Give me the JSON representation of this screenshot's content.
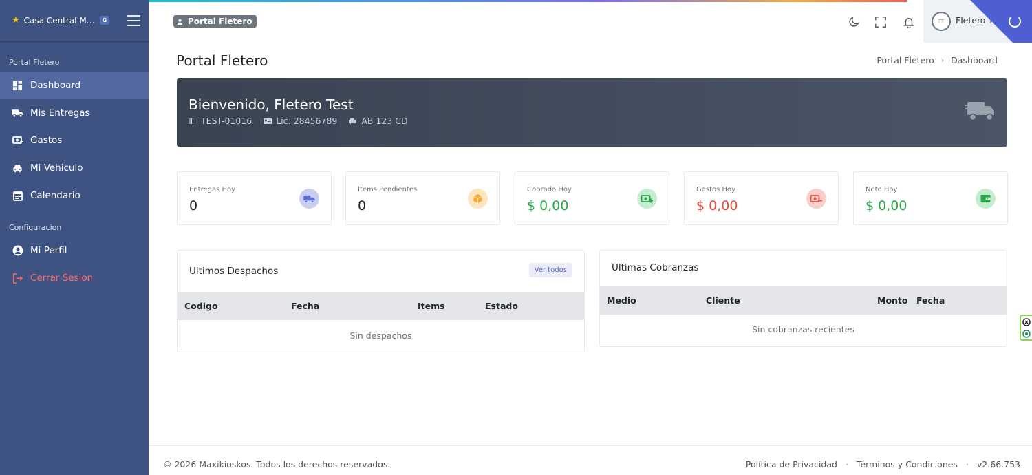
{
  "brand": {
    "name": "Casa Central Max...",
    "badge": "G"
  },
  "sidebar": {
    "section1": "Portal Fletero",
    "items": [
      {
        "label": "Dashboard",
        "icon": "dashboard-icon"
      },
      {
        "label": "Mis Entregas",
        "icon": "truck-icon"
      },
      {
        "label": "Gastos",
        "icon": "money-out-icon"
      },
      {
        "label": "Mi Vehiculo",
        "icon": "car-icon"
      },
      {
        "label": "Calendario",
        "icon": "calendar-icon"
      }
    ],
    "section2": "Configuracion",
    "items2": [
      {
        "label": "Mi Perfil",
        "icon": "user-circle-icon"
      },
      {
        "label": "Cerrar Sesion",
        "icon": "logout-icon"
      }
    ]
  },
  "topbar": {
    "badge": "Portal Fletero",
    "user": "Fletero Test"
  },
  "page": {
    "title": "Portal Fletero",
    "breadcrumb": [
      "Portal Fletero",
      "Dashboard"
    ]
  },
  "banner": {
    "greeting": "Bienvenido, Fletero Test",
    "code": "TEST-01016",
    "license": "Lic: 28456789",
    "plate": "AB 123 CD"
  },
  "stats": [
    {
      "label": "Entregas Hoy",
      "value": "0",
      "color": "#5b6fd6"
    },
    {
      "label": "Items Pendientes",
      "value": "0",
      "color": "#f3a83b"
    },
    {
      "label": "Cobrado Hoy",
      "value": "$ 0,00",
      "color": "#28a745"
    },
    {
      "label": "Gastos Hoy",
      "value": "$ 0,00",
      "color": "#e74c3c"
    },
    {
      "label": "Neto Hoy",
      "value": "$ 0,00",
      "color": "#28a745"
    }
  ],
  "despachos": {
    "title": "Ultimos Despachos",
    "button": "Ver todos",
    "columns": [
      "Codigo",
      "Fecha",
      "Items",
      "Estado"
    ],
    "empty": "Sin despachos"
  },
  "cobranzas": {
    "title": "Ultimas Cobranzas",
    "columns": [
      "Medio",
      "Cliente",
      "Monto",
      "Fecha"
    ],
    "empty": "Sin cobranzas recientes"
  },
  "footer": {
    "copyright": "© 2026 Maxikioskos. Todos los derechos reservados.",
    "privacy": "Política de Privacidad",
    "terms": "Términos y Condiciones",
    "version": "v2.66.753",
    "separator": "·"
  }
}
